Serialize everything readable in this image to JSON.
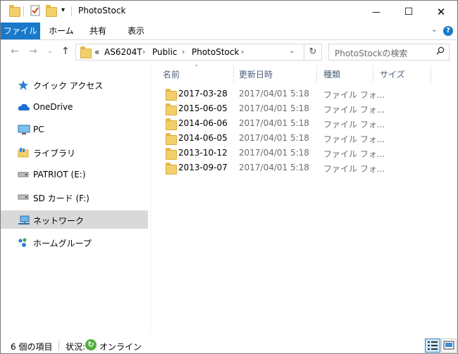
{
  "window": {
    "title": "PhotoStock",
    "minimize_glyph": "—",
    "maximize_glyph": "☐",
    "close_glyph": "✕"
  },
  "ribbon": {
    "tabs": [
      "ファイル",
      "ホーム",
      "共有",
      "表示"
    ],
    "help_glyph": "?",
    "expand_glyph": "⌄"
  },
  "address": {
    "prefix": "«",
    "crumbs": [
      "AS6204T",
      "Public",
      "PhotoStock"
    ],
    "separator": "›"
  },
  "search": {
    "placeholder": "PhotoStockの検索",
    "icon": "search-icon"
  },
  "nav": {
    "items": [
      {
        "label": "クイック アクセス",
        "icon": "star-icon"
      },
      {
        "label": "OneDrive",
        "icon": "cloud-icon"
      },
      {
        "label": "PC",
        "icon": "monitor-icon"
      },
      {
        "label": "ライブラリ",
        "icon": "library-icon"
      },
      {
        "label": "PATRIOT (E:)",
        "icon": "drive-icon"
      },
      {
        "label": "SD カード (F:)",
        "icon": "sd-card-icon"
      },
      {
        "label": "ネットワーク",
        "icon": "network-icon"
      },
      {
        "label": "ホームグループ",
        "icon": "homegroup-icon"
      }
    ],
    "selected": "ネットワーク"
  },
  "columns": [
    "名前",
    "更新日時",
    "種類",
    "サイズ"
  ],
  "files": [
    {
      "name": "2017-03-28",
      "date": "2017/04/01 5:18",
      "type": "ファイル フォ..."
    },
    {
      "name": "2015-06-05",
      "date": "2017/04/01 5:18",
      "type": "ファイル フォ..."
    },
    {
      "name": "2014-06-06",
      "date": "2017/04/01 5:18",
      "type": "ファイル フォ..."
    },
    {
      "name": "2014-06-05",
      "date": "2017/04/01 5:18",
      "type": "ファイル フォ..."
    },
    {
      "name": "2013-10-12",
      "date": "2017/04/01 5:18",
      "type": "ファイル フォ..."
    },
    {
      "name": "2013-09-07",
      "date": "2017/04/01 5:18",
      "type": "ファイル フォ..."
    }
  ],
  "status": {
    "count": "6 個の項目",
    "state_label": "状況:",
    "state_value": "オンライン"
  },
  "colors": {
    "accent": "#1979ca",
    "folder": "#f3cf6b",
    "selected_nav": "#d9d9d9",
    "header_text": "#4c607a"
  }
}
